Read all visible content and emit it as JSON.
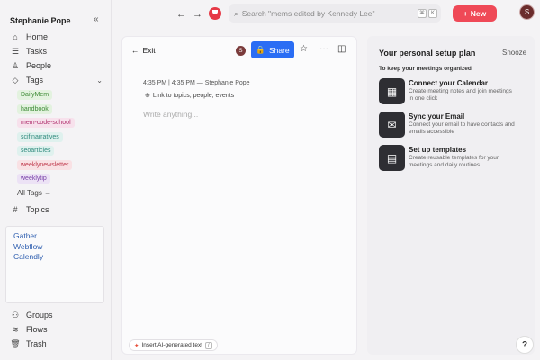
{
  "sidebar": {
    "user_name": "Stephanie Pope",
    "collapse_glyph": "«",
    "items_top": [
      {
        "label": "Home",
        "icon": "home-icon",
        "glyph": "⌂"
      },
      {
        "label": "Tasks",
        "icon": "tasks-icon",
        "glyph": "☰"
      },
      {
        "label": "People",
        "icon": "people-icon",
        "glyph": "♙"
      },
      {
        "label": "Tags",
        "icon": "tag-icon",
        "glyph": "◇"
      }
    ],
    "tags": [
      {
        "label": "DailyMem",
        "bg": "#e3f2df",
        "fg": "#3c8a34"
      },
      {
        "label": "handbook",
        "bg": "#e3f2df",
        "fg": "#3c8a34"
      },
      {
        "label": "mem-code-school",
        "bg": "#f7e1ec",
        "fg": "#b0306e"
      },
      {
        "label": "scifinarratives",
        "bg": "#dff1ee",
        "fg": "#2f8a7d"
      },
      {
        "label": "seoarticles",
        "bg": "#dff1ee",
        "fg": "#2f8a7d"
      },
      {
        "label": "weeklynewsletter",
        "bg": "#f9e1e4",
        "fg": "#c03a4d"
      },
      {
        "label": "weeklytip",
        "bg": "#ece2f5",
        "fg": "#7a42a8"
      }
    ],
    "all_tags": "All Tags →",
    "topics": {
      "label": "Topics",
      "glyph": "#"
    },
    "saved_links": [
      "Gather",
      "Webflow",
      "Calendly"
    ],
    "items_bottom": [
      {
        "label": "Groups",
        "icon": "groups-icon",
        "glyph": "⚇"
      },
      {
        "label": "Flows",
        "icon": "flows-icon",
        "glyph": "≋"
      },
      {
        "label": "Trash",
        "icon": "trash-icon",
        "glyph": "🗑"
      }
    ]
  },
  "topbar": {
    "back_glyph": "←",
    "forward_glyph": "→",
    "search_placeholder": "Search \"mems edited by Kennedy Lee\"",
    "search_kbd": [
      "⌘",
      "K"
    ],
    "new_label": "New",
    "new_glyph": "+",
    "avatar_initial": "S"
  },
  "editor": {
    "exit_label": "Exit",
    "exit_glyph": "←",
    "collab_initial": "S",
    "share_label": "Share",
    "star_glyph": "☆",
    "more_glyph": "···",
    "panel_glyph": "◫",
    "meta": "4:35 PM | 4:35 PM — Stephanie Pope",
    "link_topics": "Link to topics, people, events",
    "placeholder": "Write anything...",
    "ai_label": "Insert AI-generated text",
    "ai_key": "/"
  },
  "setup": {
    "title": "Your personal setup plan",
    "snooze": "Snooze",
    "subtitle": "To keep your meetings organized",
    "steps": [
      {
        "title": "Connect your Calendar",
        "desc": "Create meeting notes and join meetings in one click",
        "glyph": "▦"
      },
      {
        "title": "Sync your Email",
        "desc": "Connect your email to have contacts and emails accessible",
        "glyph": "✉"
      },
      {
        "title": "Set up templates",
        "desc": "Create reusable templates for your meetings and daily routines",
        "glyph": "▤"
      }
    ]
  },
  "help_glyph": "?"
}
